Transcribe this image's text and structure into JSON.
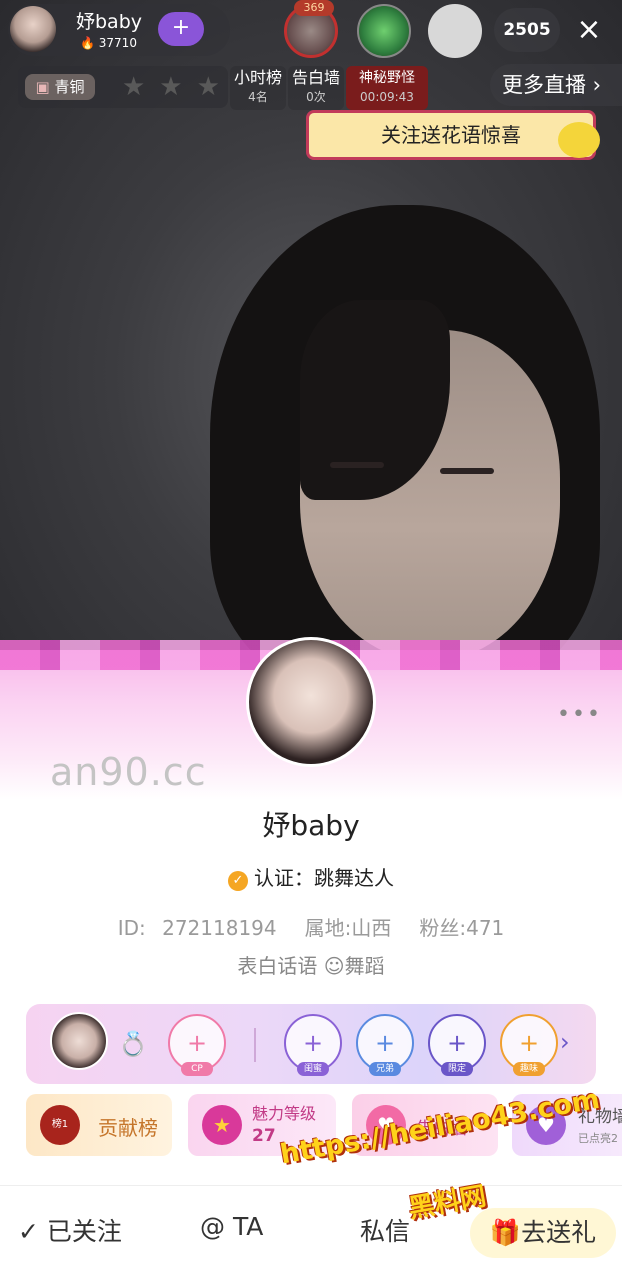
{
  "host": {
    "name": "妤baby",
    "score": "37710",
    "follow_icon": "+"
  },
  "viewers": {
    "badge": "369",
    "count": "2505"
  },
  "close_icon": "×",
  "rank": {
    "badge": "青铜",
    "stars": "★★★"
  },
  "boards": {
    "hour": {
      "title": "小时榜",
      "value": "4名"
    },
    "wall": {
      "title": "告白墙",
      "value": "0次"
    },
    "mystery": {
      "title": "神秘野怪",
      "value": "00:09:43"
    }
  },
  "more_live": "更多直播 ›",
  "promo": "关注送花语惊喜",
  "profile": {
    "more": "•••",
    "name": "妤baby",
    "cert_label": "认证：跳舞达人",
    "id": "ID: 272118194",
    "location": "属地:山西",
    "fans": "粉丝:471",
    "bio": "表白话语 ☺舞蹈"
  },
  "watermark": "an90.cc",
  "relations": {
    "slots": [
      {
        "tag": "CP",
        "color": "#f07aa8"
      },
      {
        "tag": "闺蜜",
        "color": "#8a62d6"
      },
      {
        "tag": "兄弟",
        "color": "#5a8ae0"
      },
      {
        "tag": "限定",
        "color": "#6a56c8"
      },
      {
        "tag": "趣味",
        "color": "#f0a030"
      }
    ],
    "plus": "+",
    "arrow": "›"
  },
  "tiles": {
    "contrib": {
      "label": "贡献榜",
      "badge": "榜1"
    },
    "charm": {
      "label": "魅力等级",
      "value": "27"
    },
    "wall": {
      "label": "告白墙"
    },
    "gift": {
      "label": "礼物墙",
      "sub": "已点亮2"
    }
  },
  "actions": {
    "followed": "✓ 已关注",
    "mention": "@ TA",
    "message": "私信",
    "send_gift": "去送礼"
  },
  "ad": {
    "url": "https://heiliao43.com",
    "name": "黑料网"
  }
}
